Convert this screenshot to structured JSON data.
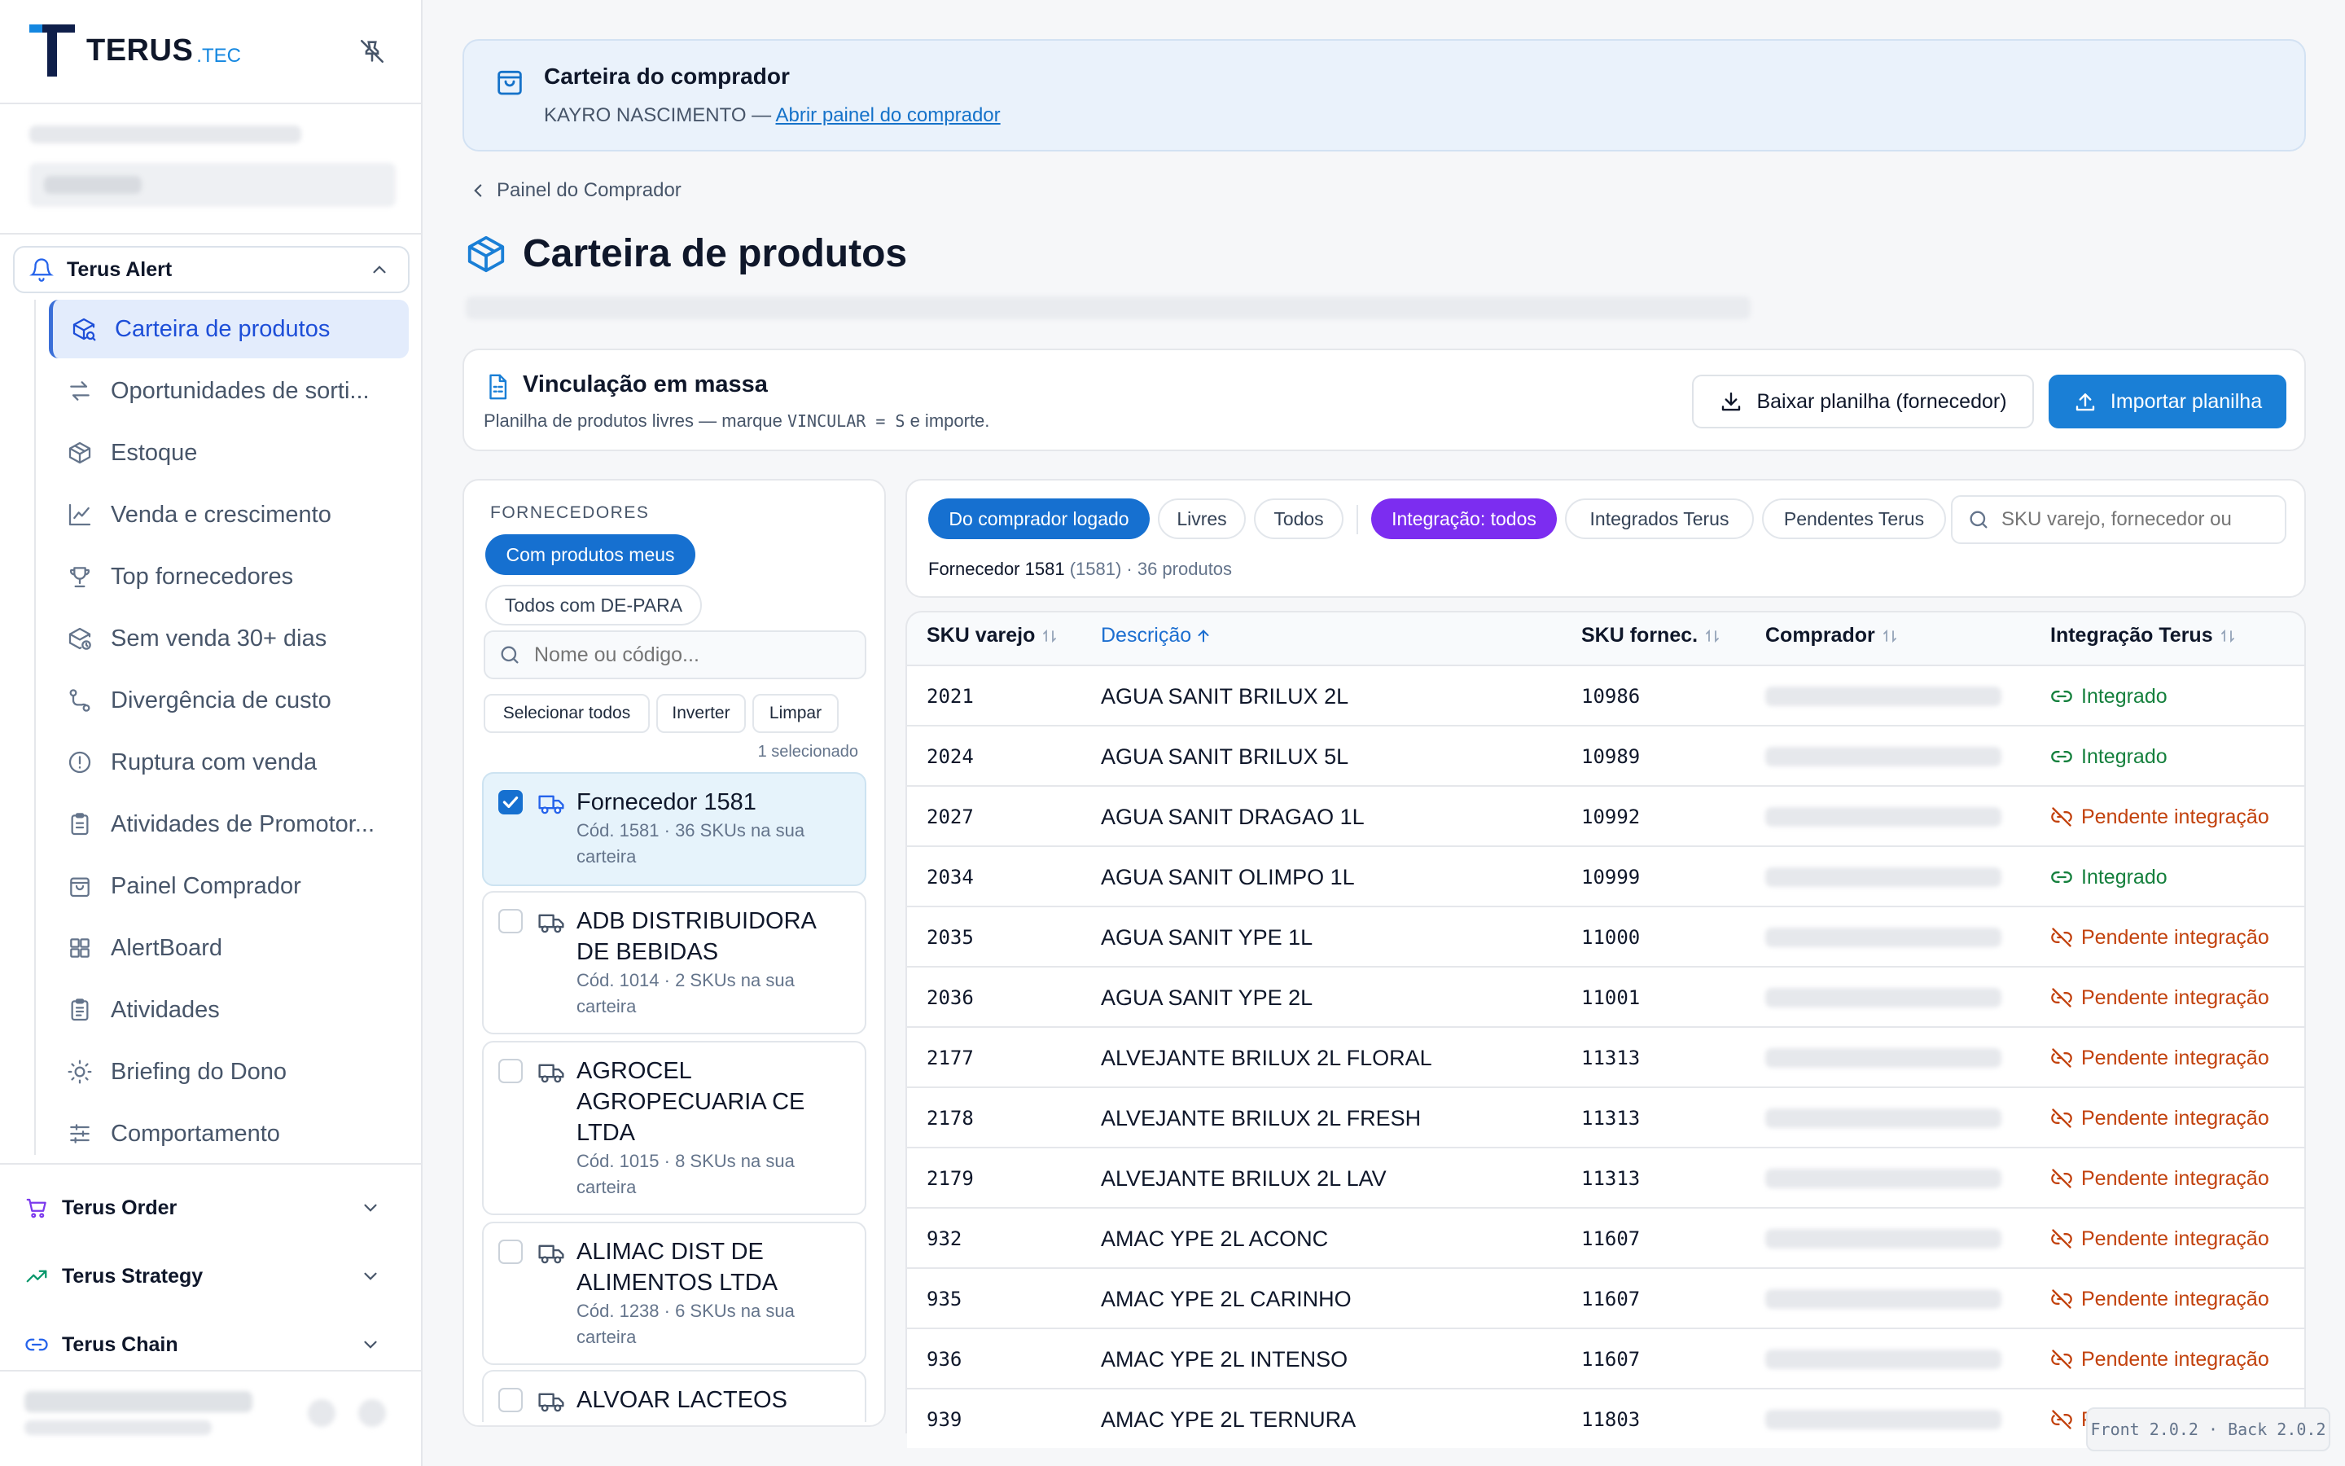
{
  "brand": {
    "name": "TERUS",
    "suffix": ".TEC",
    "accent": "#1487e0"
  },
  "sidebar": {
    "groups": [
      {
        "label": "Terus Alert",
        "expanded": true
      },
      {
        "label": "Terus Order"
      },
      {
        "label": "Terus Strategy"
      },
      {
        "label": "Terus Chain"
      }
    ],
    "items": [
      {
        "label": "Carteira de produtos",
        "icon": "package-search-icon",
        "active": true
      },
      {
        "label": "Oportunidades de sorti...",
        "icon": "arrows-exchange-icon"
      },
      {
        "label": "Estoque",
        "icon": "box-icon"
      },
      {
        "label": "Venda e crescimento",
        "icon": "line-chart-icon"
      },
      {
        "label": "Top fornecedores",
        "icon": "trophy-icon"
      },
      {
        "label": "Sem venda 30+ dias",
        "icon": "package-clock-icon"
      },
      {
        "label": "Divergência de custo",
        "icon": "route-icon"
      },
      {
        "label": "Ruptura com venda",
        "icon": "alert-circle-icon"
      },
      {
        "label": "Atividades de Promotor...",
        "icon": "clipboard-icon"
      },
      {
        "label": "Painel Comprador",
        "icon": "shopping-bag-icon"
      },
      {
        "label": "AlertBoard",
        "icon": "grid-icon"
      },
      {
        "label": "Atividades",
        "icon": "clipboard-list-icon"
      },
      {
        "label": "Briefing do Dono",
        "icon": "sun-icon"
      },
      {
        "label": "Comportamento",
        "icon": "sliders-icon"
      }
    ]
  },
  "banner": {
    "title": "Carteira do comprador",
    "buyer": "KAYRO NASCIMENTO",
    "separator": " — ",
    "link": "Abrir painel do comprador"
  },
  "breadcrumb": {
    "label": "Painel do Comprador"
  },
  "page": {
    "title": "Carteira de produtos"
  },
  "mass": {
    "title": "Vinculação em massa",
    "desc_a": "Planilha de produtos livres — marque ",
    "desc_code": "VINCULAR = S",
    "desc_b": " e importe.",
    "download_label": "Baixar planilha (fornecedor)",
    "import_label": "Importar planilha"
  },
  "suppliers": {
    "heading": "FORNECEDORES",
    "filter_mine": "Com produtos meus",
    "filter_all": "Todos com DE-PARA",
    "search_placeholder": "Nome ou código...",
    "select_all": "Selecionar todos",
    "invert": "Inverter",
    "clear": "Limpar",
    "selected_count": "1 selecionado",
    "list": [
      {
        "name": "Fornecedor 1581",
        "meta": "Cód. 1581 · 36 SKUs na sua carteira",
        "selected": true
      },
      {
        "name": "ADB DISTRIBUIDORA DE BEBIDAS",
        "meta": "Cód. 1014 · 2 SKUs na sua carteira"
      },
      {
        "name": "AGROCEL AGROPECUARIA CE LTDA",
        "meta": "Cód. 1015 · 8 SKUs na sua carteira"
      },
      {
        "name": "ALIMAC DIST DE ALIMENTOS LTDA",
        "meta": "Cód. 1238 · 6 SKUs na sua carteira"
      },
      {
        "name": "ALVOAR LACTEOS",
        "meta": ""
      }
    ]
  },
  "filters": {
    "pills": [
      "Do comprador logado",
      "Livres",
      "Todos"
    ],
    "integration": "Integração: todos",
    "integrated": "Integrados Terus",
    "pending": "Pendentes Terus",
    "search_placeholder": "SKU varejo, fornecedor ou"
  },
  "selection": {
    "name": "Fornecedor 1581",
    "code": "(1581)",
    "count": "· 36 produtos"
  },
  "table": {
    "columns": {
      "sku": "SKU varejo",
      "desc": "Descrição",
      "sku_forn": "SKU fornec.",
      "buyer": "Comprador",
      "integ": "Integração Terus"
    },
    "status_colors": {
      "ok": "#15803d",
      "pending": "#c2410c"
    },
    "rows": [
      {
        "sku": "2021",
        "desc": "AGUA SANIT BRILUX 2L",
        "forn": "10986",
        "status": "Integrado",
        "ok": true
      },
      {
        "sku": "2024",
        "desc": "AGUA SANIT BRILUX 5L",
        "forn": "10989",
        "status": "Integrado",
        "ok": true
      },
      {
        "sku": "2027",
        "desc": "AGUA SANIT DRAGAO 1L",
        "forn": "10992",
        "status": "Pendente integração",
        "ok": false
      },
      {
        "sku": "2034",
        "desc": "AGUA SANIT OLIMPO 1L",
        "forn": "10999",
        "status": "Integrado",
        "ok": true
      },
      {
        "sku": "2035",
        "desc": "AGUA SANIT YPE 1L",
        "forn": "11000",
        "status": "Pendente integração",
        "ok": false
      },
      {
        "sku": "2036",
        "desc": "AGUA SANIT YPE 2L",
        "forn": "11001",
        "status": "Pendente integração",
        "ok": false
      },
      {
        "sku": "2177",
        "desc": "ALVEJANTE BRILUX 2L FLORAL",
        "forn": "11313",
        "status": "Pendente integração",
        "ok": false
      },
      {
        "sku": "2178",
        "desc": "ALVEJANTE BRILUX 2L FRESH",
        "forn": "11313",
        "status": "Pendente integração",
        "ok": false
      },
      {
        "sku": "2179",
        "desc": "ALVEJANTE BRILUX 2L LAV",
        "forn": "11313",
        "status": "Pendente integração",
        "ok": false
      },
      {
        "sku": "932",
        "desc": "AMAC YPE 2L ACONC",
        "forn": "11607",
        "status": "Pendente integração",
        "ok": false
      },
      {
        "sku": "935",
        "desc": "AMAC YPE 2L CARINHO",
        "forn": "11607",
        "status": "Pendente integração",
        "ok": false
      },
      {
        "sku": "936",
        "desc": "AMAC YPE 2L INTENSO",
        "forn": "11607",
        "status": "Pendente integração",
        "ok": false
      },
      {
        "sku": "939",
        "desc": "AMAC YPE 2L TERNURA",
        "forn": "11803",
        "status": "P",
        "ok": false
      }
    ]
  },
  "version": "Front 2.0.2 · Back 2.0.2"
}
